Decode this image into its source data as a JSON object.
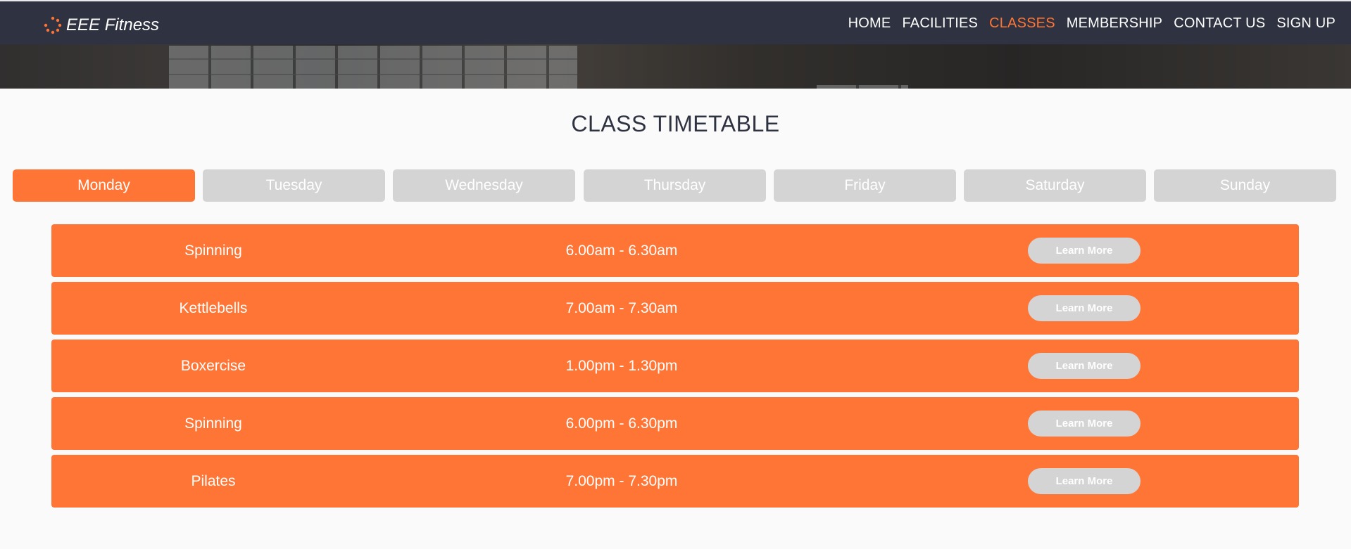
{
  "brand": {
    "name": "EEE Fitness",
    "icon": "spinner-dots-icon",
    "accent": "#ff7535"
  },
  "nav": {
    "items": [
      {
        "label": "HOME"
      },
      {
        "label": "FACILITIES"
      },
      {
        "label": "CLASSES"
      },
      {
        "label": "MEMBERSHIP"
      },
      {
        "label": "CONTACT US"
      },
      {
        "label": "SIGN UP"
      }
    ],
    "active": "CLASSES"
  },
  "page": {
    "title": "CLASS TIMETABLE"
  },
  "days": {
    "items": [
      {
        "label": "Monday"
      },
      {
        "label": "Tuesday"
      },
      {
        "label": "Wednesday"
      },
      {
        "label": "Thursday"
      },
      {
        "label": "Friday"
      },
      {
        "label": "Saturday"
      },
      {
        "label": "Sunday"
      }
    ],
    "selected": "Monday"
  },
  "classes": [
    {
      "name": "Spinning",
      "time": "6.00am - 6.30am",
      "button": "Learn More"
    },
    {
      "name": "Kettlebells",
      "time": "7.00am - 7.30am",
      "button": "Learn More"
    },
    {
      "name": "Boxercise",
      "time": "1.00pm - 1.30pm",
      "button": "Learn More"
    },
    {
      "name": "Spinning",
      "time": "6.00pm - 6.30pm",
      "button": "Learn More"
    },
    {
      "name": "Pilates",
      "time": "7.00pm - 7.30pm",
      "button": "Learn More"
    }
  ],
  "colors": {
    "navbar": "#2f3241",
    "accent": "#ff7535",
    "inactive": "#d4d4d4",
    "background": "#fafafa"
  }
}
